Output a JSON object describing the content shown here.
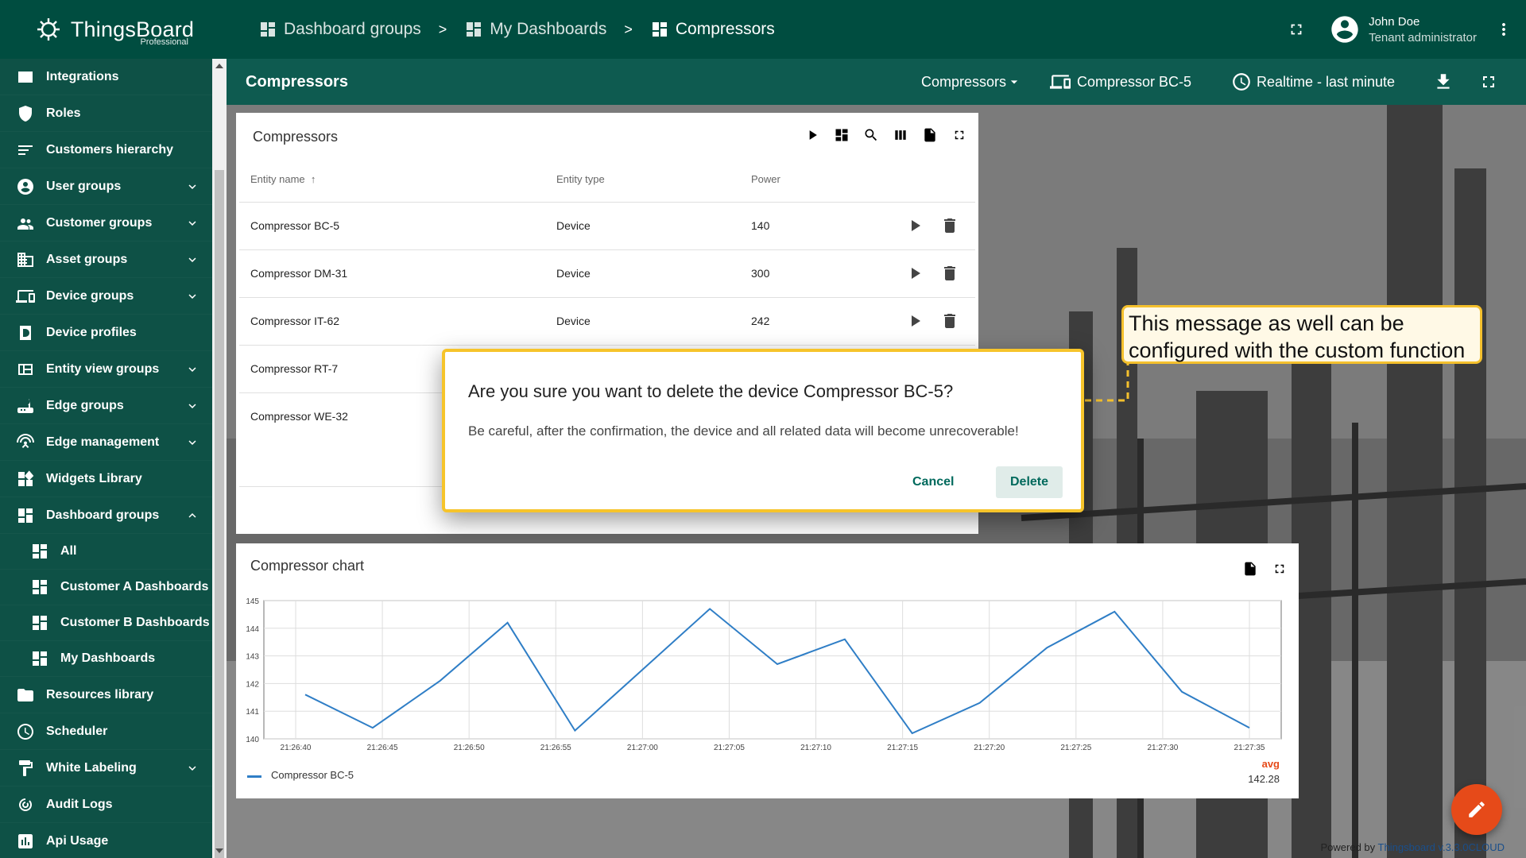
{
  "brand": {
    "name": "ThingsBoard",
    "edition": "Professional"
  },
  "sidebar": {
    "items": [
      {
        "label": "Integrations",
        "icon": "integrations-icon"
      },
      {
        "label": "Roles",
        "icon": "shield-icon"
      },
      {
        "label": "Customers hierarchy",
        "icon": "hierarchy-icon"
      },
      {
        "label": "User groups",
        "icon": "account-circle-icon",
        "expand": true
      },
      {
        "label": "Customer groups",
        "icon": "supervisor-icon",
        "expand": true
      },
      {
        "label": "Asset groups",
        "icon": "domain-icon",
        "expand": true
      },
      {
        "label": "Device groups",
        "icon": "devices-icon",
        "expand": true
      },
      {
        "label": "Device profiles",
        "icon": "device-profile-icon"
      },
      {
        "label": "Entity view groups",
        "icon": "view-quilt-icon",
        "expand": true
      },
      {
        "label": "Edge groups",
        "icon": "router-icon",
        "expand": true
      },
      {
        "label": "Edge management",
        "icon": "settings-input-antenna-icon",
        "expand": true
      },
      {
        "label": "Widgets Library",
        "icon": "widgets-icon"
      },
      {
        "label": "Dashboard groups",
        "icon": "dashboard-icon",
        "expand": true,
        "open": true
      }
    ],
    "sub_items": [
      {
        "label": "All"
      },
      {
        "label": "Customer A Dashboards"
      },
      {
        "label": "Customer B Dashboards"
      },
      {
        "label": "My Dashboards"
      }
    ],
    "items_after": [
      {
        "label": "Resources library",
        "icon": "folder-icon"
      },
      {
        "label": "Scheduler",
        "icon": "schedule-icon"
      },
      {
        "label": "White Labeling",
        "icon": "format-paint-icon",
        "expand": true
      },
      {
        "label": "Audit Logs",
        "icon": "track-changes-icon"
      },
      {
        "label": "Api Usage",
        "icon": "insert-chart-icon"
      }
    ]
  },
  "breadcrumbs": [
    {
      "label": "Dashboard groups"
    },
    {
      "label": "My Dashboards"
    },
    {
      "label": "Compressors"
    }
  ],
  "breadcrumb_separator": ">",
  "user": {
    "name": "John Doe",
    "role": "Tenant administrator"
  },
  "dashboard": {
    "title": "Compressors",
    "state_select": "Compressors",
    "entity": "Compressor BC-5",
    "timewindow": "Realtime - last minute"
  },
  "entities_widget": {
    "title": "Compressors",
    "columns": [
      "Entity name",
      "Entity type",
      "Power"
    ],
    "rows": [
      {
        "name": "Compressor BC-5",
        "type": "Device",
        "power": "140"
      },
      {
        "name": "Compressor DM-31",
        "type": "Device",
        "power": "300"
      },
      {
        "name": "Compressor IT-62",
        "type": "Device",
        "power": "242"
      },
      {
        "name": "Compressor RT-7",
        "type": "",
        "power": ""
      },
      {
        "name": "Compressor WE-32",
        "type": "",
        "power": ""
      }
    ]
  },
  "chart_widget": {
    "title": "Compressor chart",
    "legend_header": "avg",
    "legend_value": "142.28"
  },
  "chart_data": {
    "type": "line",
    "title": "Compressor chart",
    "x": [
      "21:26:40",
      "21:26:43",
      "21:26:47",
      "21:26:50",
      "21:26:52",
      "21:26:55",
      "21:27:00",
      "21:27:03",
      "21:27:07",
      "21:27:10",
      "21:27:15",
      "21:27:19",
      "21:27:22",
      "21:27:26",
      "21:27:30",
      "21:27:33",
      "21:27:37"
    ],
    "x_ticks": [
      "21:26:40",
      "21:26:45",
      "21:26:50",
      "21:26:55",
      "21:27:00",
      "21:27:05",
      "21:27:10",
      "21:27:15",
      "21:27:20",
      "21:27:25",
      "21:27:30",
      "21:27:35"
    ],
    "y_ticks": [
      "145",
      "144",
      "143",
      "142",
      "141",
      "140"
    ],
    "series": [
      {
        "name": "Compressor BC-5",
        "color": "#2f7ec6",
        "values": [
          141.6,
          140.4,
          142.1,
          144.2,
          140.3,
          142.5,
          144.7,
          142.7,
          143.6,
          140.2,
          141.3,
          143.3,
          144.6,
          141.7,
          140.4
        ]
      }
    ],
    "ylim": [
      140,
      145
    ],
    "grid": true,
    "legend": "bottom-left"
  },
  "dialog": {
    "title": "Are you sure you want to delete the device Compressor BC-5?",
    "message": "Be careful, after the confirmation, the device and all related data will become unrecoverable!",
    "cancel_label": "Cancel",
    "delete_label": "Delete"
  },
  "callout": {
    "text": "This message as well can be configured with the custom function"
  },
  "footer": {
    "prefix": "Powered by",
    "brand": "Thingsboard v.3.3.0CLOUD"
  },
  "colors": {
    "primary": "#004d40",
    "accent": "#00695c",
    "highlight": "#f6c42b",
    "fab": "#e64a19"
  }
}
